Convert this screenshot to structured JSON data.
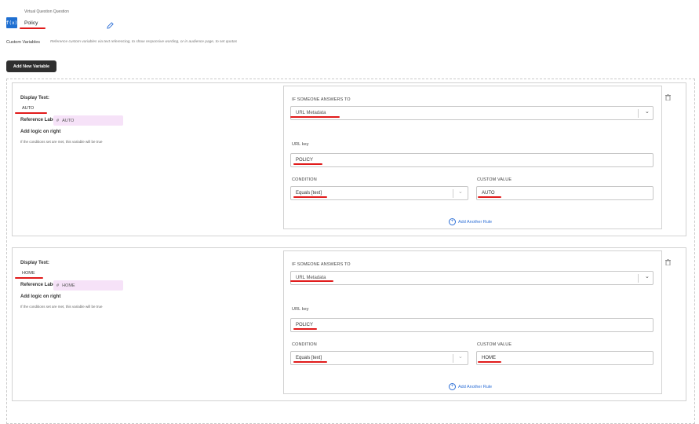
{
  "header": {
    "icon_label": "f(x)",
    "question_caption": "Virtual Question Question",
    "question_name": "Policy",
    "custom_variables_title": "Custom Variables",
    "custom_variables_help": "Reference custom variables via text referencing, to show responsive wording, or in audience page, to set quotas",
    "add_button_label": "Add New Variable"
  },
  "variables": [
    {
      "display_text_label": "Display Text:",
      "display_text": "AUTO",
      "reference_label_title": "Reference Label:",
      "reference_hash": "#",
      "reference_label": "AUTO",
      "logic_title": "Add logic on right",
      "logic_help": "If the conditions set are met, this variable will be true",
      "if_answers_label": "IF SOMEONE ANSWERS TO",
      "answers_value": "URL Metadata",
      "url_key_label": "URL key",
      "url_key_value": "POLICY",
      "condition_label": "CONDITION",
      "condition_value": "Equals [text]",
      "custom_value_label": "CUSTOM VALUE",
      "custom_value": "AUTO",
      "add_rule_label": "Add Another Rule"
    },
    {
      "display_text_label": "Display Text:",
      "display_text": "HOME",
      "reference_label_title": "Reference Label:",
      "reference_hash": "#",
      "reference_label": "HOME",
      "logic_title": "Add logic on right",
      "logic_help": "If the conditions set are met, this variable will be true",
      "if_answers_label": "IF SOMEONE ANSWERS TO",
      "answers_value": "URL Metadata",
      "url_key_label": "URL key",
      "url_key_value": "POLICY",
      "condition_label": "CONDITION",
      "condition_value": "Equals [text]",
      "custom_value_label": "CUSTOM VALUE",
      "custom_value": "HOME",
      "add_rule_label": "Add Another Rule"
    }
  ],
  "icons": {
    "edit": "pencil-icon",
    "delete": "trash-icon",
    "dropdown": "chevron-down-icon",
    "add_rule": "plus-circle-icon"
  },
  "colors": {
    "accent": "#1f6fd1",
    "annotation_red": "#e11b1b",
    "chip_pink": "#f6e2f8",
    "dark_button": "#2f2f2f"
  }
}
